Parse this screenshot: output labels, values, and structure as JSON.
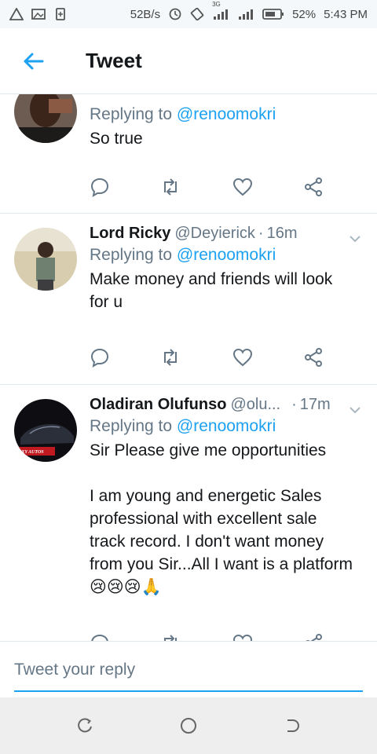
{
  "status_bar": {
    "net_speed": "52B/s",
    "network_label": "3G",
    "battery": "52%",
    "time": "5:43 PM"
  },
  "header": {
    "title": "Tweet",
    "back_icon": "arrow-left-icon"
  },
  "tweets": [
    {
      "name": "",
      "handle": "",
      "time": "",
      "replying_prefix": "Replying to ",
      "replying_to": "@renoomokri",
      "lines": [
        "So true"
      ]
    },
    {
      "name": "Lord Ricky",
      "handle": "@Deyierick",
      "time": "16m",
      "replying_prefix": "Replying to ",
      "replying_to": "@renoomokri",
      "lines": [
        "Make money and friends will look",
        "for u"
      ]
    },
    {
      "name": "Oladiran Olufunso",
      "handle": "@olu...",
      "time": "17m",
      "replying_prefix": "Replying to ",
      "replying_to": "@renoomokri",
      "avatar_text": "OXY AUTOS",
      "lines": [
        "Sir Please give me opportunities",
        "",
        "I am young and energetic Sales",
        "professional with excellent sale",
        "track record. I don't want money",
        "from you Sir...All I want is a platform",
        "😢😢😢🙏"
      ]
    }
  ],
  "action_icons": [
    "reply-icon",
    "retweet-icon",
    "like-icon",
    "share-icon"
  ],
  "composer": {
    "placeholder": "Tweet your reply"
  },
  "colors": {
    "accent": "#1da1f2",
    "secondary_text": "#657786",
    "divider": "#e1e8ed"
  }
}
